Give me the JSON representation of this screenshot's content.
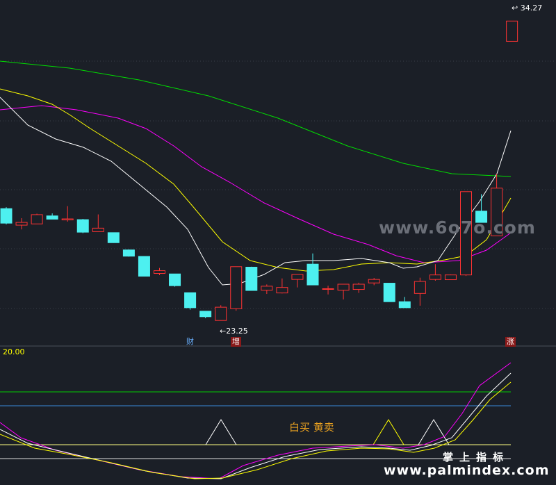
{
  "price_labels": {
    "high": "34.27",
    "low": "23.25"
  },
  "event_tags": [
    {
      "text": "财",
      "color": "#6ab0ff",
      "bg": "#1b1f27"
    },
    {
      "text": "增",
      "color": "#ffffff",
      "bg": "#8a1a1a"
    },
    {
      "text": "涨",
      "color": "#ffffff",
      "bg": "#8a1a1a"
    }
  ],
  "indicator": {
    "value": "20.00",
    "legend": "白买 黄卖"
  },
  "watermark": "www.6o7o.com",
  "brand": {
    "cn": "掌上指标",
    "url": "www.palmindex.com"
  },
  "colors": {
    "bg": "#1b1f27",
    "up": "#ff3333",
    "down": "#4df0f0",
    "ma5": "#ffffff",
    "ma10": "#ffff00",
    "ma20": "#ff00ff",
    "ma60": "#00ff00"
  },
  "chart_data": {
    "type": "candlestick",
    "ylim": [
      22,
      35
    ],
    "candles": [
      {
        "o": 26.77,
        "h": 26.83,
        "l": 26.14,
        "c": 26.19
      },
      {
        "o": 26.11,
        "h": 26.39,
        "l": 25.94,
        "c": 26.22
      },
      {
        "o": 26.16,
        "h": 26.57,
        "l": 26.16,
        "c": 26.53
      },
      {
        "o": 26.48,
        "h": 26.58,
        "l": 26.35,
        "c": 26.35
      },
      {
        "o": 26.32,
        "h": 26.87,
        "l": 26.25,
        "c": 26.36
      },
      {
        "o": 26.33,
        "h": 26.36,
        "l": 25.79,
        "c": 25.83
      },
      {
        "o": 25.85,
        "h": 26.54,
        "l": 25.85,
        "c": 25.99
      },
      {
        "o": 25.81,
        "h": 25.81,
        "l": 25.4,
        "c": 25.41
      },
      {
        "o": 25.12,
        "h": 25.14,
        "l": 24.85,
        "c": 24.87
      },
      {
        "o": 24.86,
        "h": 24.86,
        "l": 24.06,
        "c": 24.07
      },
      {
        "o": 24.18,
        "h": 24.4,
        "l": 24.11,
        "c": 24.29
      },
      {
        "o": 24.16,
        "h": 24.16,
        "l": 23.65,
        "c": 23.69
      },
      {
        "o": 23.41,
        "h": 23.41,
        "l": 22.73,
        "c": 22.81
      },
      {
        "o": 22.67,
        "h": 22.67,
        "l": 22.39,
        "c": 22.45
      },
      {
        "o": 22.3,
        "h": 22.91,
        "l": 22.3,
        "c": 22.83
      },
      {
        "o": 22.77,
        "h": 24.45,
        "l": 22.69,
        "c": 24.45
      },
      {
        "o": 24.43,
        "h": 24.45,
        "l": 23.5,
        "c": 23.5
      },
      {
        "o": 23.51,
        "h": 23.74,
        "l": 23.36,
        "c": 23.67
      },
      {
        "o": 23.4,
        "h": 23.98,
        "l": 23.38,
        "c": 23.62
      },
      {
        "o": 23.94,
        "h": 24.1,
        "l": 23.62,
        "c": 24.14
      },
      {
        "o": 24.55,
        "h": 24.98,
        "l": 23.72,
        "c": 23.72
      },
      {
        "o": 23.57,
        "h": 23.69,
        "l": 23.34,
        "c": 23.57
      },
      {
        "o": 23.51,
        "h": 23.74,
        "l": 23.14,
        "c": 23.75
      },
      {
        "o": 23.54,
        "h": 23.81,
        "l": 23.4,
        "c": 23.75
      },
      {
        "o": 23.8,
        "h": 24.0,
        "l": 23.71,
        "c": 23.94
      },
      {
        "o": 23.79,
        "h": 23.79,
        "l": 23.05,
        "c": 23.05
      },
      {
        "o": 23.05,
        "h": 23.24,
        "l": 22.86,
        "c": 22.81
      },
      {
        "o": 23.38,
        "h": 24.01,
        "l": 22.89,
        "c": 23.86
      },
      {
        "o": 23.94,
        "h": 24.55,
        "l": 23.89,
        "c": 24.12
      },
      {
        "o": 23.93,
        "h": 24.14,
        "l": 23.93,
        "c": 24.12
      },
      {
        "o": 24.12,
        "h": 27.45,
        "l": 24.08,
        "c": 27.45
      },
      {
        "o": 26.67,
        "h": 27.35,
        "l": 26.22,
        "c": 26.22
      },
      {
        "o": 25.68,
        "h": 28.16,
        "l": 25.68,
        "c": 27.59
      },
      {
        "o": 33.46,
        "h": 34.27,
        "l": 33.46,
        "c": 34.27
      }
    ]
  }
}
